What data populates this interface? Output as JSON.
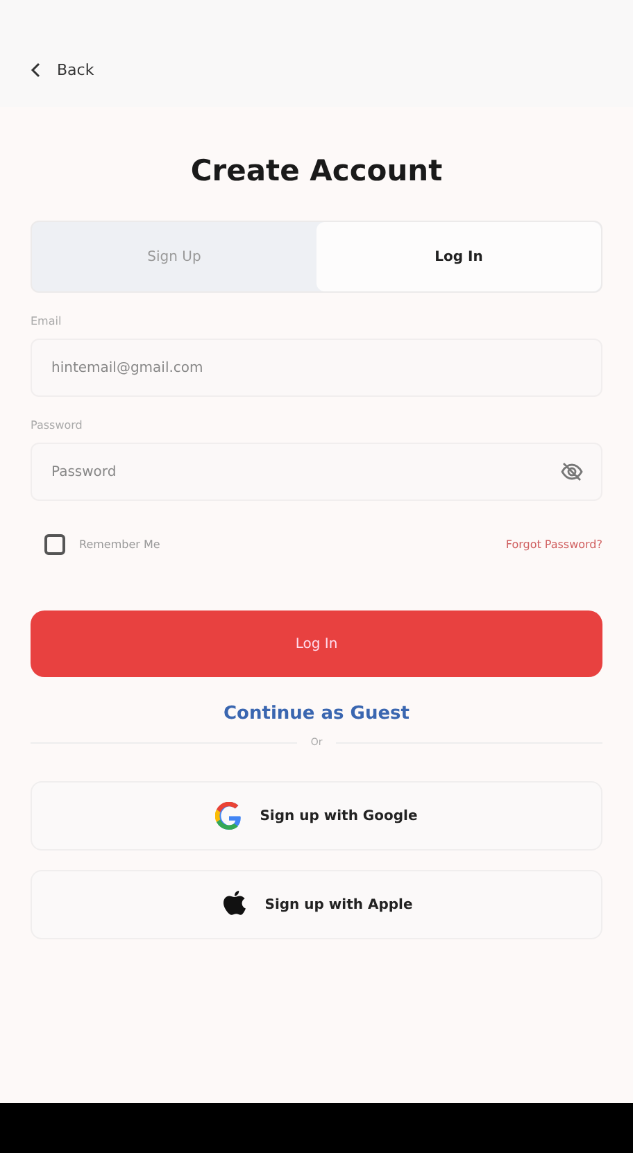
{
  "header": {
    "back_label": "Back"
  },
  "title": "Create Account",
  "tabs": [
    {
      "label": "Sign Up",
      "selected": false
    },
    {
      "label": "Log In",
      "selected": true
    }
  ],
  "fields": [
    {
      "label": "Email",
      "placeholder": "hintemail@gmail.com",
      "kind": "text"
    },
    {
      "label": "Password",
      "placeholder": "Password",
      "kind": "password"
    }
  ],
  "remember": {
    "label": "Remember Me",
    "checked": false
  },
  "forgot_link": "Forgot Password?",
  "primary_button": "Log In",
  "guest_link": "Continue as Guest",
  "divider_label": "Or",
  "social_buttons": [
    {
      "label": "Sign up with Google",
      "kind": "google"
    },
    {
      "label": "Sign up with Apple",
      "kind": "apple"
    }
  ]
}
